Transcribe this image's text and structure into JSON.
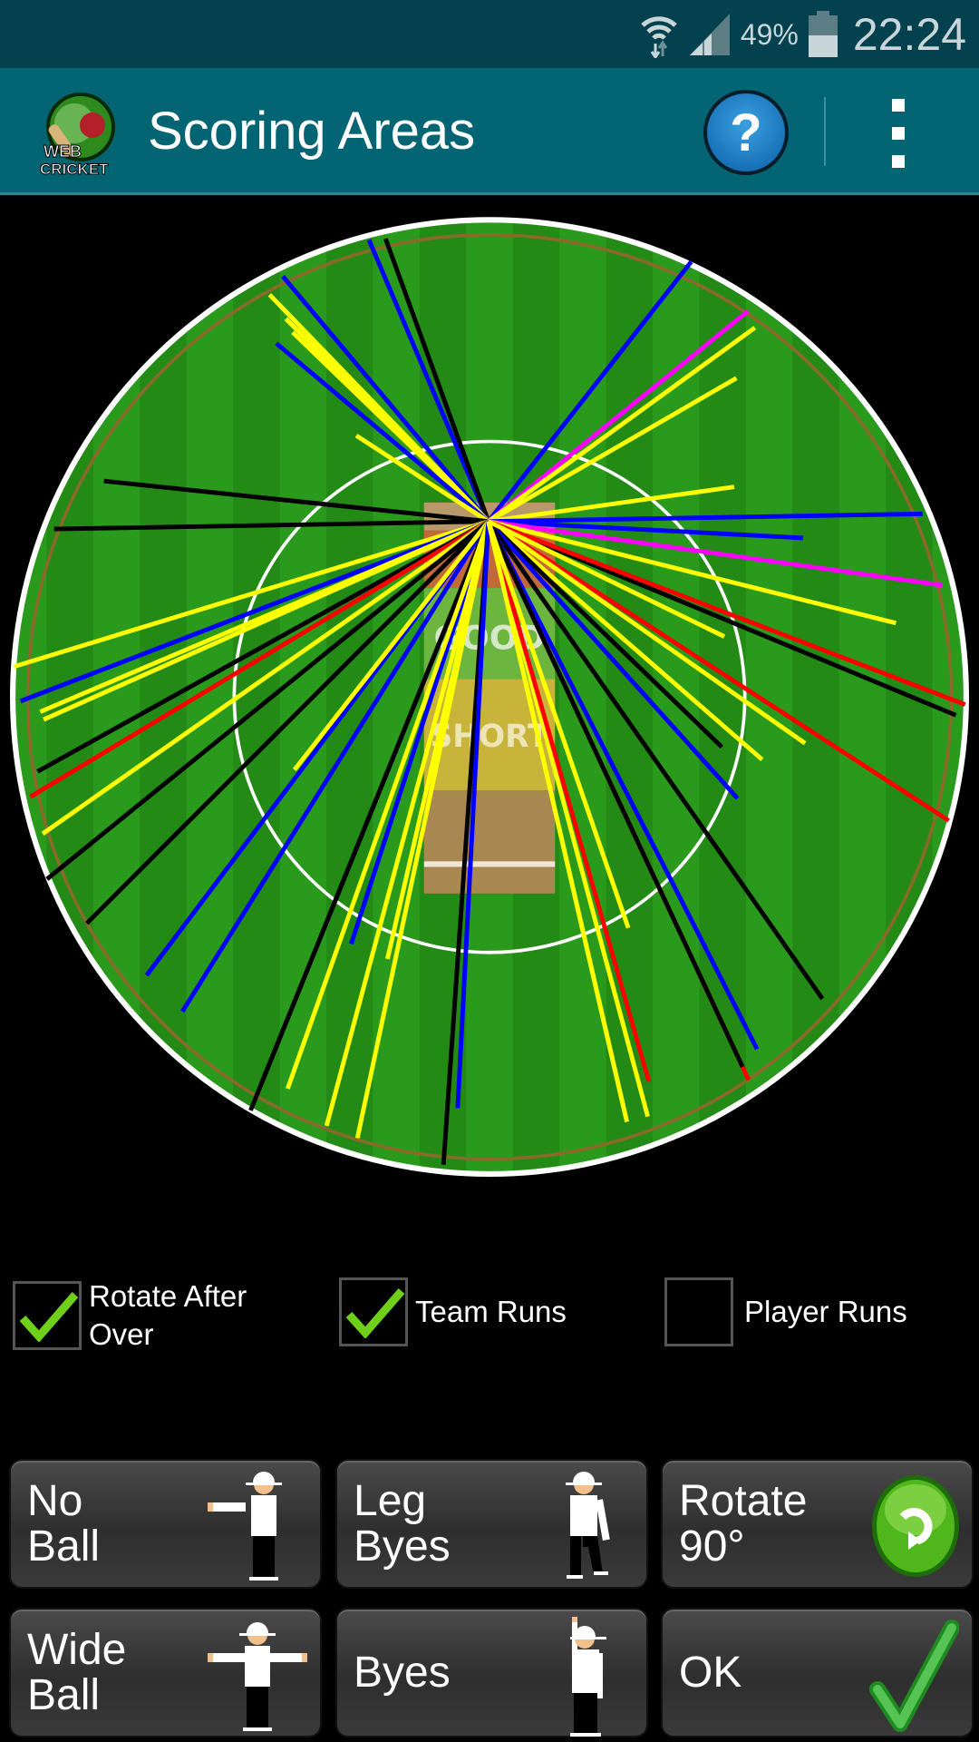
{
  "status_bar": {
    "battery": "49%",
    "time": "22:24",
    "icons": [
      "wifi-icon",
      "signal-icon",
      "battery-icon"
    ]
  },
  "app_bar": {
    "logo_text": "WEB CRICKET",
    "title": "Scoring Areas",
    "help_label": "?",
    "icons": [
      "help-icon",
      "overflow-menu-icon"
    ]
  },
  "pitch": {
    "good_label": "GOOD",
    "short_label": "SHORT"
  },
  "shot_colors": {
    "yellow": "#ffff00",
    "blue": "#0000ff",
    "black": "#000000",
    "red": "#ff0000",
    "magenta": "#ff00ff"
  },
  "shots": [
    {
      "color": "blue",
      "angle": -40,
      "distance_ratio": 0.67
    },
    {
      "color": "blue",
      "angle": -23,
      "distance_ratio": 0.64
    },
    {
      "color": "black",
      "angle": -20,
      "distance_ratio": 0.63
    },
    {
      "color": "yellow",
      "angle": -44,
      "distance_ratio": 0.66
    },
    {
      "color": "yellow",
      "angle": -44,
      "distance_ratio": 0.63
    },
    {
      "color": "yellow",
      "angle": -45,
      "distance_ratio": 0.6
    },
    {
      "color": "yellow",
      "angle": -46,
      "distance_ratio": 0.57
    },
    {
      "color": "blue",
      "angle": -50,
      "distance_ratio": 0.58
    },
    {
      "color": "yellow",
      "angle": -57,
      "distance_ratio": 0.33
    },
    {
      "color": "black",
      "angle": -84,
      "distance_ratio": 0.81
    },
    {
      "color": "black",
      "angle": -91,
      "distance_ratio": 0.91
    },
    {
      "color": "yellow",
      "angle": -107,
      "distance_ratio": 1.04
    },
    {
      "color": "blue",
      "angle": -111,
      "distance_ratio": 1.05
    },
    {
      "color": "yellow",
      "angle": -113,
      "distance_ratio": 1.02
    },
    {
      "color": "yellow",
      "angle": -114,
      "distance_ratio": 1.02
    },
    {
      "color": "black",
      "angle": -119,
      "distance_ratio": 1.08
    },
    {
      "color": "red",
      "angle": -121,
      "distance_ratio": 1.12
    },
    {
      "color": "yellow",
      "angle": -125,
      "distance_ratio": 1.14
    },
    {
      "color": "black",
      "angle": -129,
      "distance_ratio": 1.19
    },
    {
      "color": "black",
      "angle": -135,
      "distance_ratio": 1.19
    },
    {
      "color": "blue",
      "angle": -143,
      "distance_ratio": 1.19
    },
    {
      "color": "blue",
      "angle": -148,
      "distance_ratio": 1.21
    },
    {
      "color": "yellow",
      "angle": -142,
      "distance_ratio": 0.66
    },
    {
      "color": "blue",
      "angle": -162,
      "distance_ratio": 0.93
    },
    {
      "color": "yellow",
      "angle": -167,
      "distance_ratio": 0.94
    },
    {
      "color": "black",
      "angle": -158,
      "distance_ratio": 1.27
    },
    {
      "color": "black",
      "angle": -158,
      "distance_ratio": 1.33
    },
    {
      "color": "yellow",
      "angle": -160.5,
      "distance_ratio": 1.26
    },
    {
      "color": "yellow",
      "angle": -165,
      "distance_ratio": 1.31
    },
    {
      "color": "yellow",
      "angle": -168,
      "distance_ratio": 1.32
    },
    {
      "color": "black",
      "angle": -176,
      "distance_ratio": 1.35
    },
    {
      "color": "blue",
      "angle": -177,
      "distance_ratio": 1.23
    },
    {
      "color": "blue",
      "angle": 38,
      "distance_ratio": 0.69
    },
    {
      "color": "magenta",
      "angle": 51,
      "distance_ratio": 0.7
    },
    {
      "color": "yellow",
      "angle": 54,
      "distance_ratio": 0.69
    },
    {
      "color": "yellow",
      "angle": 60,
      "distance_ratio": 0.6
    },
    {
      "color": "yellow",
      "angle": 82,
      "distance_ratio": 0.52
    },
    {
      "color": "blue",
      "angle": 89,
      "distance_ratio": 0.91
    },
    {
      "color": "blue",
      "angle": 93,
      "distance_ratio": 0.66
    },
    {
      "color": "magenta",
      "angle": 98,
      "distance_ratio": 0.96
    },
    {
      "color": "yellow",
      "angle": 104,
      "distance_ratio": 0.88
    },
    {
      "color": "black",
      "angle": 112.5,
      "distance_ratio": 1.06
    },
    {
      "color": "red",
      "angle": 111,
      "distance_ratio": 1.07
    },
    {
      "color": "red",
      "angle": 123,
      "distance_ratio": 1.15
    },
    {
      "color": "yellow",
      "angle": 125,
      "distance_ratio": 0.81
    },
    {
      "color": "yellow",
      "angle": 131,
      "distance_ratio": 0.76
    },
    {
      "color": "black",
      "angle": 134,
      "distance_ratio": 0.68
    },
    {
      "color": "blue",
      "angle": 138,
      "distance_ratio": 0.78
    },
    {
      "color": "black",
      "angle": 145,
      "distance_ratio": 1.22
    },
    {
      "color": "blue",
      "angle": 153,
      "distance_ratio": 1.24
    },
    {
      "color": "red",
      "angle": 155,
      "distance_ratio": 1.29
    },
    {
      "color": "black",
      "angle": 155,
      "distance_ratio": 1.26
    },
    {
      "color": "yellow",
      "angle": 165,
      "distance_ratio": 1.29
    },
    {
      "color": "yellow",
      "angle": 167,
      "distance_ratio": 1.29
    },
    {
      "color": "red",
      "angle": 164,
      "distance_ratio": 1.22
    },
    {
      "color": "yellow",
      "angle": 161,
      "distance_ratio": 0.9
    },
    {
      "color": "yellow",
      "angle": 116,
      "distance_ratio": 0.55
    },
    {
      "color": "yellow",
      "angle": 167,
      "distance_ratio": 1.26
    }
  ],
  "options": {
    "rotate_after_over": {
      "label": "Rotate After Over",
      "checked": true
    },
    "team_runs": {
      "label": "Team Runs",
      "checked": true
    },
    "player_runs": {
      "label": "Player Runs",
      "checked": false
    }
  },
  "buttons": {
    "no_ball": "No\nBall",
    "leg_byes": "Leg\nByes",
    "rotate": "Rotate\n90°",
    "wide_ball": "Wide\nBall",
    "byes": "Byes",
    "ok": "OK"
  }
}
